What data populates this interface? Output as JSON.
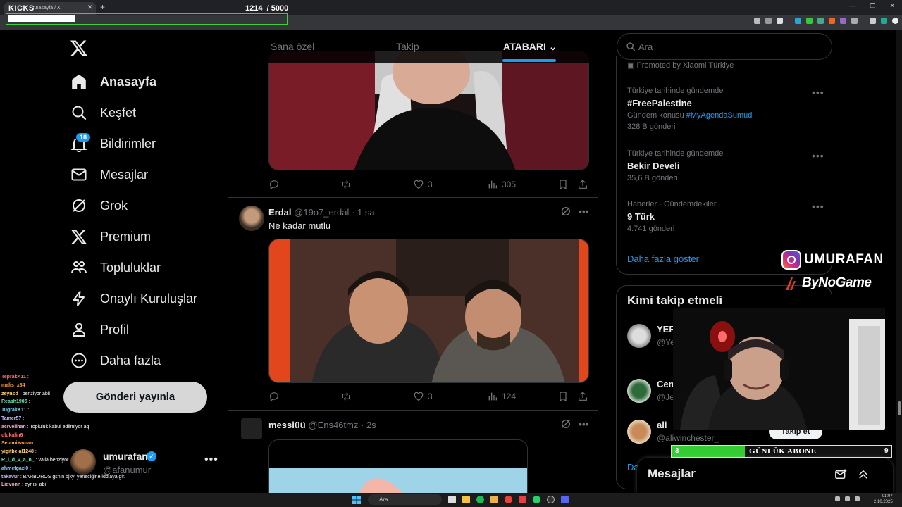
{
  "browser": {
    "overlay_brand": "KICKS",
    "tab_title": "Anasayfa / X",
    "goal_current": "1214",
    "goal_total": "/ 5000",
    "goal_fraction": 0.2428
  },
  "nav": {
    "items": [
      {
        "label": "Anasayfa",
        "icon": "home-icon",
        "active": true
      },
      {
        "label": "Keşfet",
        "icon": "search-icon"
      },
      {
        "label": "Bildirimler",
        "icon": "bell-icon"
      },
      {
        "label": "Mesajlar",
        "icon": "mail-icon"
      },
      {
        "label": "Grok",
        "icon": "grok-icon"
      },
      {
        "label": "Premium",
        "icon": "x-icon"
      },
      {
        "label": "Topluluklar",
        "icon": "communities-icon"
      },
      {
        "label": "Onaylı Kuruluşlar",
        "icon": "lightning-icon"
      },
      {
        "label": "Profil",
        "icon": "person-icon"
      },
      {
        "label": "Daha fazla",
        "icon": "more-circle-icon"
      }
    ],
    "notification_count": "18",
    "post_button": "Gönderi yayınla",
    "account": {
      "name": "umurafan",
      "handle": "@afanumur",
      "verified_mark": "✓",
      "more": "•••"
    }
  },
  "chat": [
    {
      "user": "TeprakK11",
      "text": ""
    },
    {
      "user": "malis_x84",
      "text": ""
    },
    {
      "user": "zeynsd",
      "text": "benziyor abil"
    },
    {
      "user": "Reash1905",
      "text": ""
    },
    {
      "user": "TugrakK11",
      "text": ""
    },
    {
      "user": "Tamer57",
      "text": ""
    },
    {
      "user": "acrvelihan",
      "text": "Topluluk kabul edilmiyor aq"
    },
    {
      "user": "ulukalin6",
      "text": ""
    },
    {
      "user": "SelamiYaman",
      "text": ""
    },
    {
      "user": "yigitbelal1248",
      "text": ""
    },
    {
      "user": "R_i_d_v_a_n_",
      "text": "valla benziyor"
    },
    {
      "user": "ahmetgazi0",
      "text": ""
    },
    {
      "user": "takavur",
      "text": "BARBOROS gsnin bjkyi yeneciğine iddiaya gir."
    },
    {
      "user": "Lidvonn",
      "text": "aynısı abi"
    }
  ],
  "timeline": {
    "tabs": [
      "Sana özel",
      "Takip",
      "ATABARI"
    ],
    "post1": {
      "likes": "3",
      "views": "305"
    },
    "post2": {
      "name": "Erdal",
      "handle": "@19o7_erdal",
      "time": "· 1 sa",
      "text": "Ne kadar mutlu",
      "likes": "3",
      "views": "124"
    },
    "post3": {
      "name": "messiüü",
      "handle": "@Ens46tmz",
      "time": "· 2s"
    }
  },
  "search": {
    "placeholder": "Ara"
  },
  "trends": {
    "promoted": "Promoted by Xiaomi Türkiye",
    "items": [
      {
        "context": "Türkiye tarihinde gündemde",
        "name": "#FreePalestine",
        "sub_prefix": "Gündem konusu",
        "sub_link": "#MyAgendaSumud",
        "posts": "328 B gönderi"
      },
      {
        "context": "Türkiye tarihinde gündemde",
        "name": "Bekir Develi",
        "posts": "35,6 B gönderi"
      },
      {
        "context": "Haberler · Gündemdekiler",
        "name": "9 Türk",
        "posts": "4.741 gönderi"
      }
    ],
    "show_more": "Daha fazla göster"
  },
  "who_to_follow": {
    "title": "Kimi takip etmeli",
    "users": [
      {
        "name": "YER",
        "handle": "@Ye"
      },
      {
        "name": "Cen",
        "handle": "@Je"
      },
      {
        "name": "ali",
        "handle": "@aliwinchester_"
      }
    ],
    "follow_button": "Takip et",
    "more": "Da"
  },
  "messages": {
    "title": "Mesajlar"
  },
  "stream": {
    "instagram": "UMURAFAN",
    "sponsor": "ByNoGame",
    "sub_goal_label": "GÜNLÜK ABONE",
    "sub_current": "3",
    "sub_target": "9",
    "sub_fraction": 0.333
  },
  "taskbar": {
    "search": "Ara",
    "time": "01:07",
    "date": "2.10.2025"
  },
  "colors": {
    "accent": "#1d9bf0",
    "background": "#000000",
    "border": "#2f3336",
    "muted": "#71767b"
  }
}
